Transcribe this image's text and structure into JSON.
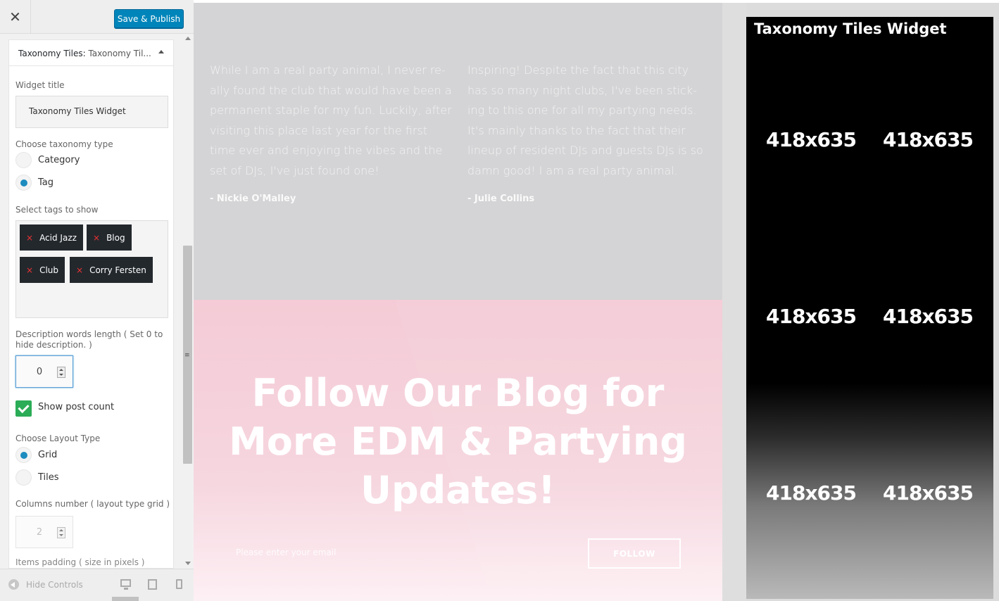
{
  "toolbar": {
    "close_glyph": "✕",
    "save_label": "Save & Publish"
  },
  "widget": {
    "header_title": "Taxonomy Tiles:",
    "header_sub": " Taxonomy Til...",
    "title_label": "Widget title",
    "title_value": "Taxonomy Tiles Widget",
    "taxonomy_label": "Choose taxonomy type",
    "taxonomy_options": [
      {
        "label": "Category",
        "selected": false
      },
      {
        "label": "Tag",
        "selected": true
      }
    ],
    "tags_label": "Select tags to show",
    "tags": [
      "Acid Jazz",
      "Blog",
      "Club",
      "Corry Fersten"
    ],
    "tag_remove_glyph": "×",
    "desc_label": "Description words length ( Set 0 to hide description. )",
    "desc_value": "0",
    "post_count_label": "Show post count",
    "post_count_checked": true,
    "layout_label": "Choose Layout Type",
    "layout_options": [
      {
        "label": "Grid",
        "selected": true
      },
      {
        "label": "Tiles",
        "selected": false
      }
    ],
    "columns_label": "Columns number ( layout type grid )",
    "columns_value": "2",
    "padding_label": "Items padding ( size in pixels )"
  },
  "footer": {
    "hide_controls_label": "Hide Controls"
  },
  "preview": {
    "quotes": [
      {
        "text": "While I am a real party animal, I never re-ally found the club that would have been a permanent staple for my fun. Luckily, after visiting this place last year for the first time ever and enjoying the vibes and the set of DJs, I've just found one!",
        "author": "- Nickie O'Malley"
      },
      {
        "text": "Inspiring! Despite the fact that this city has so many night clubs, I've been stick-ing to this one for all my partying needs. It's mainly thanks to the fact that their lineup of resident DJs and guests DJs is so damn good! I am a real party animal.",
        "author": "- Julie Collins"
      }
    ],
    "follow_heading": "Follow Our Blog for More EDM & Partying Updates!",
    "email_placeholder": "Please enter your email",
    "follow_button": "FOLLOW",
    "tax_widget_title": "Taxonomy Tiles Widget",
    "tiles": [
      "418x635",
      "418x635",
      "418x635",
      "418x635",
      "418x635",
      "418x635"
    ]
  },
  "colors": {
    "accent": "#0085ba",
    "radio_on": "#1e8cbe",
    "checkbox": "#2bac57",
    "pink_section": "#f4cbd6"
  }
}
